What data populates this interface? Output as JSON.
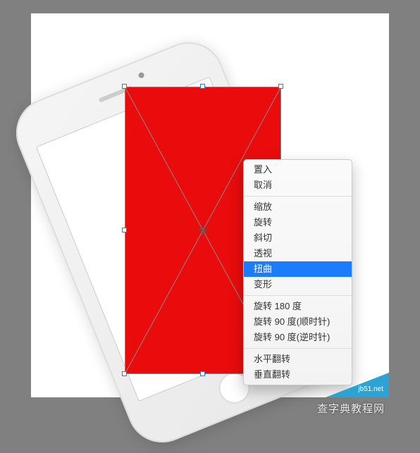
{
  "menu": {
    "group1": [
      {
        "label": "置入"
      },
      {
        "label": "取消"
      }
    ],
    "group2": [
      {
        "label": "缩放"
      },
      {
        "label": "旋转"
      },
      {
        "label": "斜切"
      },
      {
        "label": "透视"
      },
      {
        "label": "扭曲",
        "selected": true
      },
      {
        "label": "变形"
      }
    ],
    "group3": [
      {
        "label": "旋转 180 度"
      },
      {
        "label": "旋转 90 度(顺时针)"
      },
      {
        "label": "旋转 90 度(逆时针)"
      }
    ],
    "group4": [
      {
        "label": "水平翻转"
      },
      {
        "label": "垂直翻转"
      }
    ]
  },
  "watermark": {
    "small": "jb51.net",
    "main": "查字典教程网"
  },
  "colors": {
    "shape_fill": "#ea0c0c",
    "selection_highlight": "#1a7cff",
    "canvas_bg": "#ffffff",
    "workspace_bg": "#808080"
  }
}
